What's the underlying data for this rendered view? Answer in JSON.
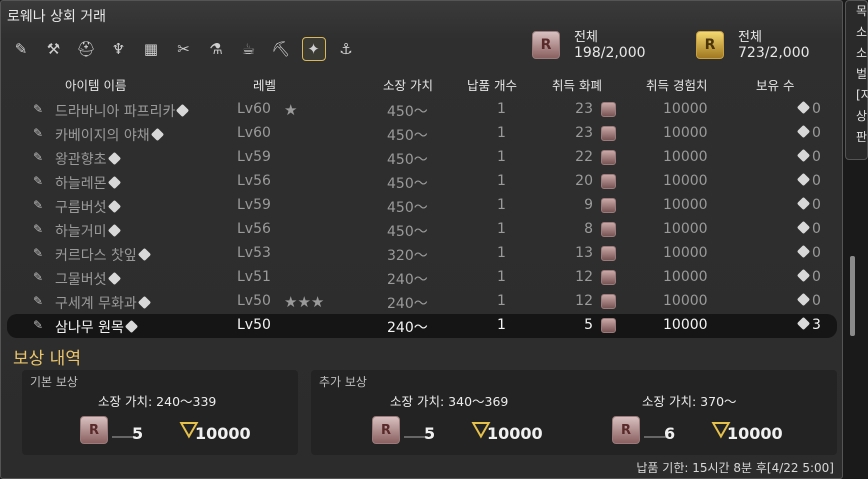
{
  "window": {
    "title": "로웨나 상회 거래"
  },
  "tools": [
    {
      "name": "tool-carpenter",
      "icon": "✎"
    },
    {
      "name": "tool-blacksmith",
      "icon": "⚒"
    },
    {
      "name": "tool-armorer",
      "icon": "⛑"
    },
    {
      "name": "tool-goldsmith",
      "icon": "♆"
    },
    {
      "name": "tool-leatherworker",
      "icon": "▦"
    },
    {
      "name": "tool-weaver",
      "icon": "✂"
    },
    {
      "name": "tool-alchemist",
      "icon": "⚗"
    },
    {
      "name": "tool-culinarian",
      "icon": "☕"
    },
    {
      "name": "tool-miner",
      "icon": "⛏"
    },
    {
      "name": "tool-botanist",
      "icon": "✦"
    },
    {
      "name": "tool-fisher",
      "icon": "⚓"
    }
  ],
  "currency": [
    {
      "label": "전체",
      "value": "198/2,000",
      "icon": "R"
    },
    {
      "label": "전체",
      "value": "723/2,000",
      "icon": "R"
    }
  ],
  "headers": {
    "item_name": "아이템 이름",
    "level": "레벨",
    "collectability": "소장 가치",
    "delivery_count": "납품 개수",
    "currency": "취득 화폐",
    "exp": "취득 경험치",
    "owned": "보유 수"
  },
  "rows": [
    {
      "name": "드라바니아 파프리카",
      "level": "Lv60",
      "stars": "★",
      "collect": "450～",
      "count": "1",
      "currency": "23",
      "exp": "10000",
      "owned": "0"
    },
    {
      "name": "카베이지의 야채",
      "level": "Lv60",
      "stars": "",
      "collect": "450～",
      "count": "1",
      "currency": "23",
      "exp": "10000",
      "owned": "0"
    },
    {
      "name": "왕관향초",
      "level": "Lv59",
      "stars": "",
      "collect": "450～",
      "count": "1",
      "currency": "22",
      "exp": "10000",
      "owned": "0"
    },
    {
      "name": "하늘레몬",
      "level": "Lv56",
      "stars": "",
      "collect": "450～",
      "count": "1",
      "currency": "20",
      "exp": "10000",
      "owned": "0"
    },
    {
      "name": "구름버섯",
      "level": "Lv59",
      "stars": "",
      "collect": "450～",
      "count": "1",
      "currency": "9",
      "exp": "10000",
      "owned": "0"
    },
    {
      "name": "하늘거미",
      "level": "Lv56",
      "stars": "",
      "collect": "450～",
      "count": "1",
      "currency": "8",
      "exp": "10000",
      "owned": "0"
    },
    {
      "name": "커르다스 찻잎",
      "level": "Lv53",
      "stars": "",
      "collect": "320～",
      "count": "1",
      "currency": "13",
      "exp": "10000",
      "owned": "0"
    },
    {
      "name": "그물버섯",
      "level": "Lv51",
      "stars": "",
      "collect": "240～",
      "count": "1",
      "currency": "12",
      "exp": "10000",
      "owned": "0"
    },
    {
      "name": "구세계 무화과",
      "level": "Lv50",
      "stars": "★★★",
      "collect": "240～",
      "count": "1",
      "currency": "12",
      "exp": "10000",
      "owned": "0"
    },
    {
      "name": "삼나무 원목",
      "level": "Lv50",
      "stars": "",
      "collect": "240～",
      "count": "1",
      "currency": "5",
      "exp": "10000",
      "owned": "3"
    }
  ],
  "selected_row": 9,
  "rewards": {
    "title": "보상 내역",
    "base": {
      "label": "기본 보상",
      "collect": "소장 가치: 240～339",
      "currency": "5",
      "exp": "10000"
    },
    "bonus": {
      "label": "추가 보상",
      "tier1": {
        "collect": "소장 가치: 340～369",
        "currency": "5",
        "exp": "10000"
      },
      "tier2": {
        "collect": "소장 가치: 370～",
        "currency": "6",
        "exp": "10000"
      }
    }
  },
  "footer": "납품 기한: 15시간 8분 후[4/22 5:00]",
  "side_panel": [
    "목",
    "소",
    "소",
    "벌",
    "[지",
    "상",
    "판"
  ],
  "colors": {
    "accent": "#e9c46a",
    "selected_border": "#d8b85a"
  }
}
